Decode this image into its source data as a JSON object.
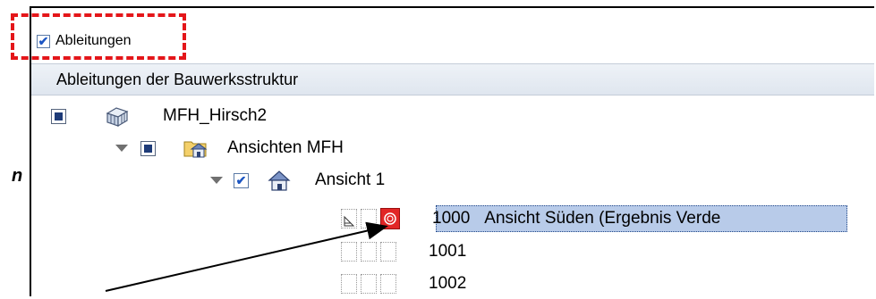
{
  "annotation": {
    "italic_letter": "n"
  },
  "filter": {
    "ableitungen_label": "Ableitungen",
    "checked": true
  },
  "header": {
    "title": "Ableitungen der Bauwerksstruktur"
  },
  "tree": {
    "root": {
      "label": "MFH_Hirsch2",
      "icon": "building-icon"
    },
    "folder": {
      "label": "Ansichten MFH",
      "icon": "folder-house-icon"
    },
    "view": {
      "label": "Ansicht 1",
      "icon": "house-icon"
    },
    "items": [
      {
        "number": "1000",
        "label": "Ansicht Süden (Ergebnis Verde",
        "selected": true
      },
      {
        "number": "1001",
        "label": ""
      },
      {
        "number": "1002",
        "label": ""
      }
    ]
  },
  "colors": {
    "highlight": "#e4161a",
    "selection": "#b8cbe9",
    "check_blue": "#1c56c3"
  }
}
